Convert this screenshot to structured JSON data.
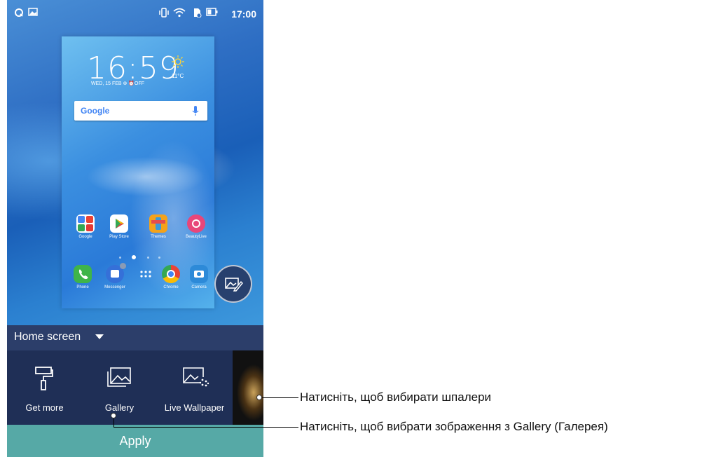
{
  "status_bar": {
    "time": "17:00"
  },
  "preview": {
    "clock": "16:59",
    "date": "WED, 15 FEB  ⊕  ⏰OFF",
    "temperature": "11°C",
    "search_logo": "Google",
    "apps_row1": [
      "Google",
      "Play Store",
      "Themes",
      "BeautyLive"
    ],
    "apps_row2": [
      "Phone",
      "Messenger",
      "",
      "Chrome",
      "Camera"
    ]
  },
  "screen_selector": {
    "label": "Home screen"
  },
  "tray": {
    "items": [
      {
        "label": "Get more",
        "icon": "paint-roller-icon"
      },
      {
        "label": "Gallery",
        "icon": "gallery-icon"
      },
      {
        "label": "Live Wallpaper",
        "icon": "live-wallpaper-icon"
      }
    ]
  },
  "apply_button": {
    "label": "Apply"
  },
  "callouts": {
    "wallpaper": "Натисніть, щоб вибирати шпалери",
    "gallery": "Натисніть, щоб вибрати зображення з Gallery (Галерея)"
  },
  "colors": {
    "tray_bg": "#1f2f56",
    "scrim_bg": "#2c3e6a",
    "apply_bg": "#56a9a6"
  }
}
